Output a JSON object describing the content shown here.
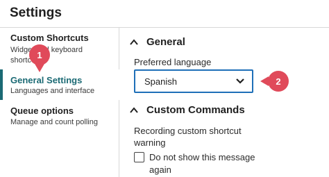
{
  "window": {
    "title": "Settings"
  },
  "sidebar": {
    "items": [
      {
        "label": "Custom Shortcuts",
        "description": "Widget and keyboard shortcuts",
        "active": false
      },
      {
        "label": "General Settings",
        "description": "Languages and interface",
        "active": true
      },
      {
        "label": "Queue options",
        "description": "Manage and count polling",
        "active": false
      }
    ]
  },
  "general": {
    "heading": "General",
    "language_label": "Preferred language",
    "language_value": "Spanish"
  },
  "custom_commands": {
    "heading": "Custom Commands",
    "warning_label_line1": "Recording custom shortcut",
    "warning_label_line2": "warning",
    "checkbox_label": "Do not show this message again",
    "checkbox_checked": false
  },
  "callouts": [
    {
      "number": "1"
    },
    {
      "number": "2"
    }
  ],
  "colors": {
    "accent": "#1b6a74",
    "focus_border": "#1e6fb8",
    "callout": "#e04a5a"
  }
}
